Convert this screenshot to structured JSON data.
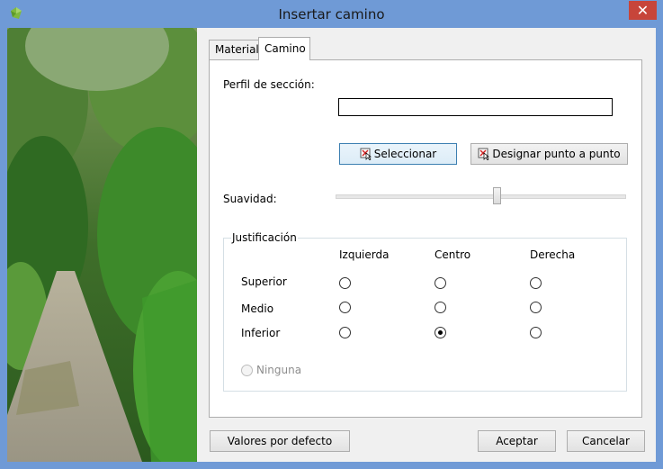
{
  "window": {
    "title": "Insertar camino",
    "close_glyph": "✕"
  },
  "tabs": [
    {
      "label": "Material",
      "active": false
    },
    {
      "label": "Camino",
      "active": true
    }
  ],
  "path": {
    "profile_label": "Perfil de sección:",
    "profile_value": "",
    "select_button": "Seleccionar",
    "pick_points_button": "Designar punto a punto",
    "smoothness_label": "Suavidad:",
    "smoothness_value": 0.56
  },
  "justification": {
    "title": "Justificación",
    "columns": [
      "Izquierda",
      "Centro",
      "Derecha"
    ],
    "rows": [
      "Superior",
      "Medio",
      "Inferior"
    ],
    "selected": {
      "row": "Inferior",
      "column": "Centro"
    },
    "none_label": "Ninguna",
    "none_enabled": false
  },
  "footer": {
    "defaults_button": "Valores por defecto",
    "accept_button": "Aceptar",
    "cancel_button": "Cancelar"
  },
  "colors": {
    "title_bar": "#6f9ad6",
    "close_button": "#c7453a",
    "focus_border": "#3c7fb1"
  }
}
